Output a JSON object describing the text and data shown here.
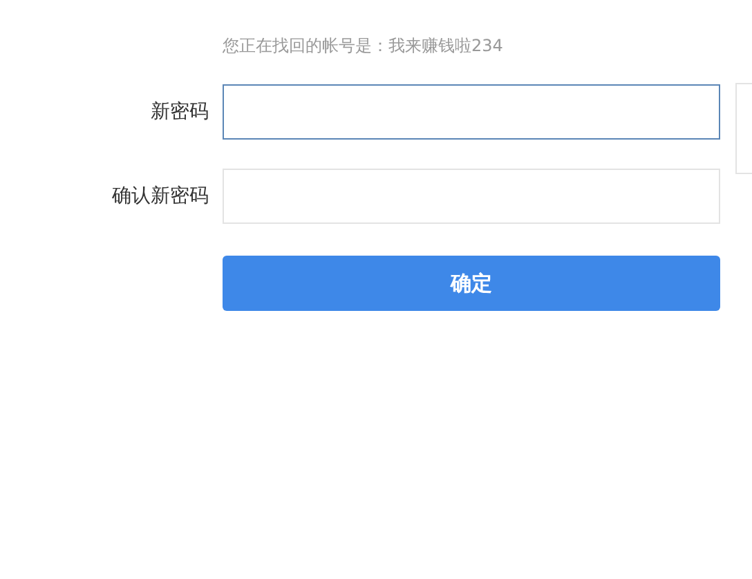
{
  "account_notice": "您正在找回的帐号是：我来赚钱啦234",
  "fields": [
    {
      "label": "新密码",
      "focused": true
    },
    {
      "label": "确认新密码",
      "focused": false
    }
  ],
  "submit_button": "确定"
}
